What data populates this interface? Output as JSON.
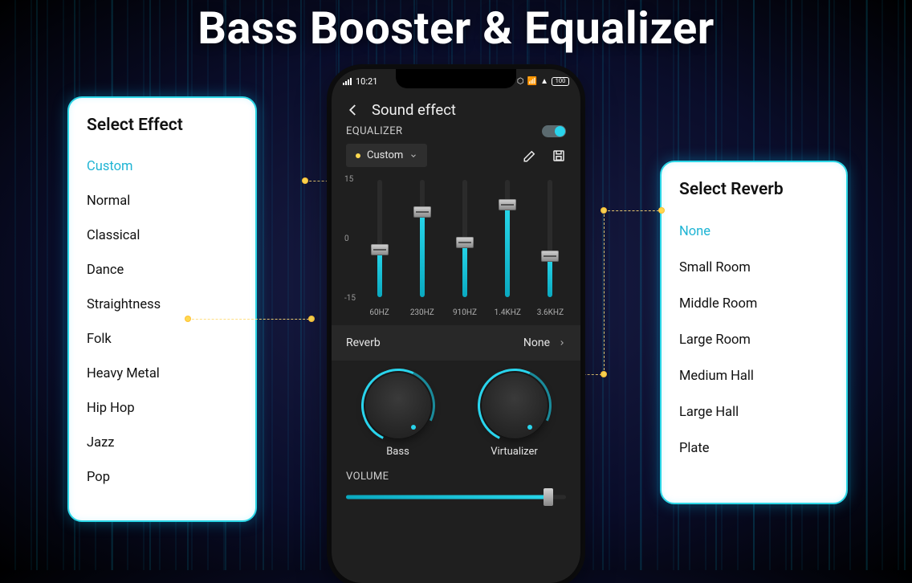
{
  "title": "Bass Booster & Equalizer",
  "effect_panel": {
    "heading": "Select Effect",
    "items": [
      "Custom",
      "Normal",
      "Classical",
      "Dance",
      "Straightness",
      "Folk",
      "Heavy Metal",
      "Hip Hop",
      "Jazz",
      "Pop"
    ],
    "selected_index": 0
  },
  "reverb_panel": {
    "heading": "Select Reverb",
    "items": [
      "None",
      "Small Room",
      "Middle Room",
      "Large Room",
      "Medium Hall",
      "Large Hall",
      "Plate"
    ],
    "selected_index": 0
  },
  "phone": {
    "status": {
      "time": "10:21",
      "battery_text": "100"
    },
    "page_title": "Sound effect",
    "equalizer": {
      "label": "EQUALIZER",
      "enabled": true,
      "preset_name": "Custom",
      "scale": {
        "max": "15",
        "mid": "0",
        "min": "-15"
      },
      "bands": [
        {
          "freq": "60HZ",
          "value_percent": 40
        },
        {
          "freq": "230HZ",
          "value_percent": 72
        },
        {
          "freq": "910HZ",
          "value_percent": 46
        },
        {
          "freq": "1.4KHZ",
          "value_percent": 78
        },
        {
          "freq": "3.6KHZ",
          "value_percent": 34
        }
      ]
    },
    "reverb": {
      "label": "Reverb",
      "value": "None"
    },
    "knobs": {
      "bass_label": "Bass",
      "virtualizer_label": "Virtualizer"
    },
    "volume": {
      "label": "VOLUME",
      "percent": 92
    }
  }
}
